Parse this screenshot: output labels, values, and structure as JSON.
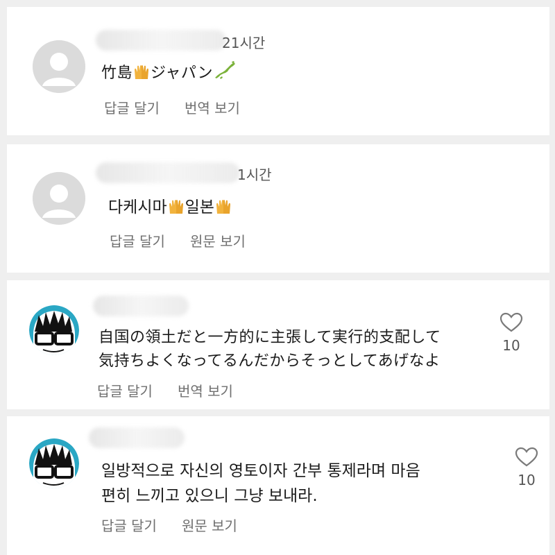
{
  "comments": [
    {
      "timestamp": "21시간",
      "text_parts": [
        "竹島",
        "ジャパン"
      ],
      "actions": [
        "답글 달기",
        "번역 보기"
      ]
    },
    {
      "timestamp": "1시간",
      "text_parts": [
        "다케시마",
        "일본"
      ],
      "actions": [
        "답글 달기",
        "원문 보기"
      ]
    },
    {
      "text_line1": "自国の領土だと一方的に主張して実行的支配して",
      "text_line2": "気持ちよくなってるんだからそっとしてあげなよ",
      "actions": [
        "답글 달기",
        "번역 보기"
      ],
      "likes": "10"
    },
    {
      "text_line1": "일방적으로 자신의 영토이자 간부 통제라며 마음",
      "text_line2": "편히 느끼고 있으니 그냥 보내라.",
      "actions": [
        "답글 달기",
        "원문 보기"
      ],
      "likes": "10"
    }
  ],
  "icons": {
    "default_avatar": "user-silhouette-icon",
    "drawn_avatar": "glasses-face-avatar",
    "raised_hands": "raising-hands-emoji",
    "japan_map": "japan-map-emoji",
    "like": "heart-outline-icon"
  },
  "colors": {
    "background": "#efefef",
    "card": "#ffffff",
    "action_text": "#6f6f6f",
    "emoji_hands": "#f2b33d",
    "japan_map": "#7bb23a"
  }
}
